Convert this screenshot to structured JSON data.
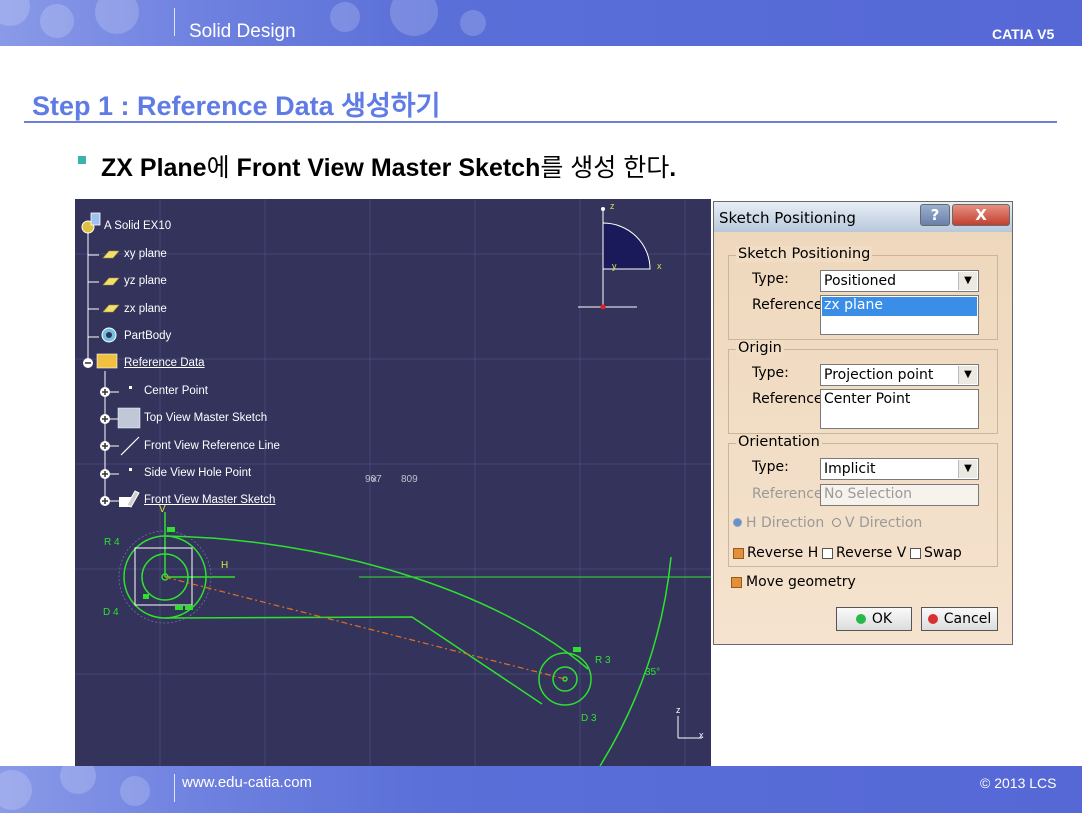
{
  "header": {
    "left_title": "Solid Design",
    "right_title": "CATIA V5"
  },
  "footer": {
    "website": "www.edu-catia.com",
    "copyright": "© 2013 LCS"
  },
  "step": {
    "title": "Step 1 : Reference Data 생성하기"
  },
  "bullet": {
    "bold1": "ZX Plane",
    "normal1": "에 ",
    "bold2": "Front View Master Sketch",
    "normal2": "를 생성 한다",
    "period": "."
  },
  "tree": {
    "root": "A Solid EX10",
    "items": [
      {
        "label": "xy plane",
        "icon": "plane-icon"
      },
      {
        "label": "yz plane",
        "icon": "plane-icon"
      },
      {
        "label": "zx plane",
        "icon": "plane-icon"
      },
      {
        "label": "PartBody",
        "icon": "part-body-icon"
      },
      {
        "label": "Reference Data",
        "icon": "geometrical-set-icon"
      }
    ],
    "children": [
      {
        "label": "Center Point",
        "icon": "point-icon"
      },
      {
        "label": "Top View Master Sketch",
        "icon": "sketch-icon"
      },
      {
        "label": "Front View Reference Line",
        "icon": "line-icon"
      },
      {
        "label": "Side View Hole Point",
        "icon": "point-icon"
      },
      {
        "label": "Front View Master Sketch",
        "icon": "sketch-icon"
      }
    ]
  },
  "viewport": {
    "cursor_readout": [
      "907",
      "809"
    ],
    "labels": {
      "r4": "R 4",
      "d4": "D 4",
      "r3": "R 3",
      "d3": "D 3",
      "angle": "35°",
      "h_axis": "H",
      "v_axis": "V",
      "compass_z": "z",
      "compass_x": "x",
      "compass_y": "y",
      "axis_z": "z",
      "axis_x": "x"
    },
    "colors": {
      "background": "#33335c",
      "geometry": "#2fe02f",
      "construction": "#e07020"
    }
  },
  "dialog": {
    "title": "Sketch Positioning",
    "help_button": "?",
    "close_button": "X",
    "sketch_positioning": {
      "group_label": "Sketch Positioning",
      "type_label": "Type:",
      "type_value": "Positioned",
      "reference_label": "Reference:",
      "reference_value": "zx plane"
    },
    "origin": {
      "group_label": "Origin",
      "type_label": "Type:",
      "type_value": "Projection point",
      "reference_label": "Reference:",
      "reference_value": "Center Point"
    },
    "orientation": {
      "group_label": "Orientation",
      "type_label": "Type:",
      "type_value": "Implicit",
      "reference_label": "Reference:",
      "reference_value": "No Selection",
      "h_direction": "H Direction",
      "v_direction": "V Direction",
      "reverse_h": "Reverse H",
      "reverse_v": "Reverse V",
      "swap": "Swap",
      "reverse_h_checked": true,
      "reverse_v_checked": false,
      "swap_checked": false
    },
    "move_geometry": "Move geometry",
    "move_geometry_checked": true,
    "ok_button": "OK",
    "cancel_button": "Cancel"
  }
}
